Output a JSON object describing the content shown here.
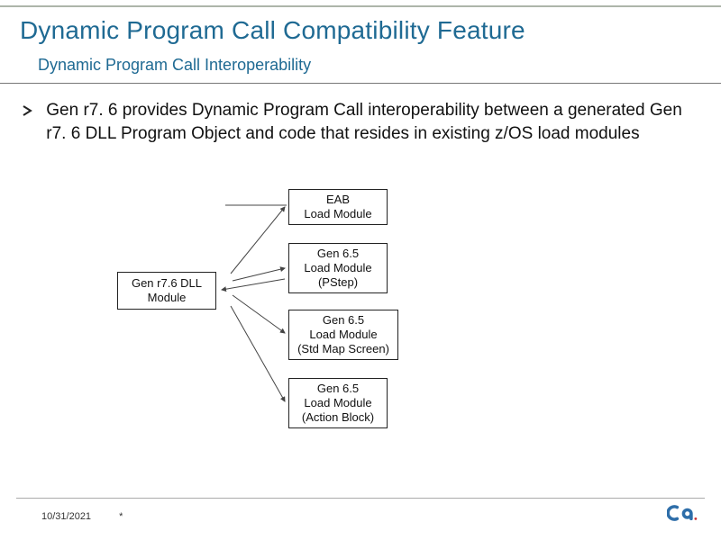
{
  "title": "Dynamic Program Call Compatibility Feature",
  "subtitle": "Dynamic Program Call Interoperability",
  "bullet": "Gen r7. 6 provides Dynamic Program Call interoperability between a generated Gen r7. 6 DLL Program Object and code that resides in existing z/OS load modules",
  "diagram": {
    "dll": {
      "line1": "Gen r7.6 DLL",
      "line2": "Module"
    },
    "eab": {
      "line1": "EAB",
      "line2": "Load Module"
    },
    "pstep": {
      "line1": "Gen 6.5",
      "line2": "Load Module",
      "line3": "(PStep)"
    },
    "map": {
      "line1": "Gen 6.5",
      "line2": "Load Module",
      "line3": "(Std Map Screen)"
    },
    "action": {
      "line1": "Gen 6.5",
      "line2": "Load Module",
      "line3": "(Action Block)"
    }
  },
  "footer": {
    "date": "10/31/2021",
    "mark": "*"
  },
  "logo": "ca"
}
